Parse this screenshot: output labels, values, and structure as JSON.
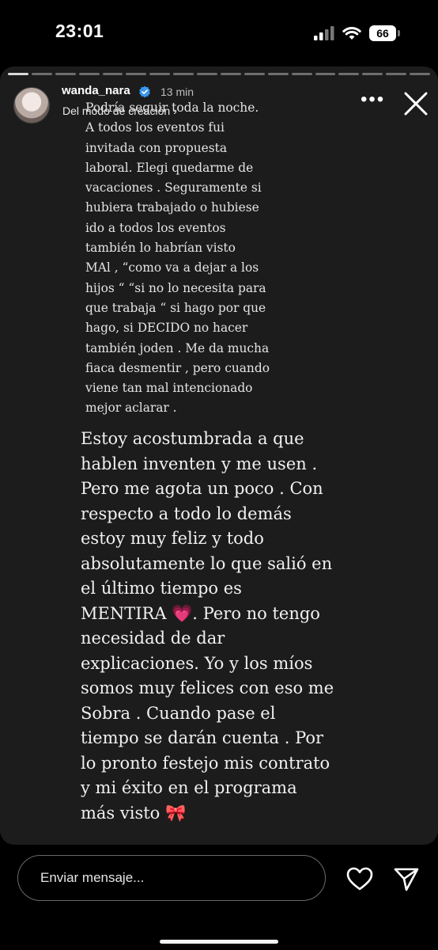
{
  "status_bar": {
    "time": "23:01",
    "battery": "66",
    "icons": [
      "signal-icon",
      "wifi-icon",
      "battery-icon"
    ]
  },
  "story": {
    "progress_segments_total": 18,
    "progress_segments_viewed": 1,
    "username": "wanda_nara",
    "verified": true,
    "time_ago": "13 min",
    "mode_label": "Del modo de creación ›",
    "text_small": "Podría seguir toda la noche.\nA todos los eventos fui\ninvitada con propuesta\nlaboral. Elegi quedarme de\nvacaciones . Seguramente si\nhubiera trabajado o hubiese\nido a todos los eventos\ntambién lo habrían  visto\nMAl , “como va a dejar a los\nhijos “ “si no lo necesita para\nque trabaja “ si hago por que\nhago,  si DECIDO no hacer\ntambién joden . Me da mucha\nfiaca desmentir , pero cuando\nviene tan mal intencionado\nmejor aclarar .",
    "text_large": "Estoy acostumbrada a que\nhablen inventen y me usen .\nPero me agota un poco . Con\nrespecto a todo lo demás\nestoy muy feliz y todo\nabsolutamente lo que salió en\nel último tiempo es\nMENTIRA 💗. Pero no tengo\nnecesidad de dar\nexplicaciones. Yo y los míos\nsomos muy felices con eso me\nSobra .  Cuando pase el\ntiempo se darán cuenta . Por\nlo pronto festejo mis contrato\ny mi éxito en el programa\nmás visto 🎀"
  },
  "footer": {
    "message_placeholder": "Enviar mensaje...",
    "icons": [
      "heart-icon",
      "send-icon"
    ]
  },
  "colors": {
    "story_background": "#1c1c1c",
    "page_background": "#000000",
    "verified_badge": "#3897f0"
  }
}
